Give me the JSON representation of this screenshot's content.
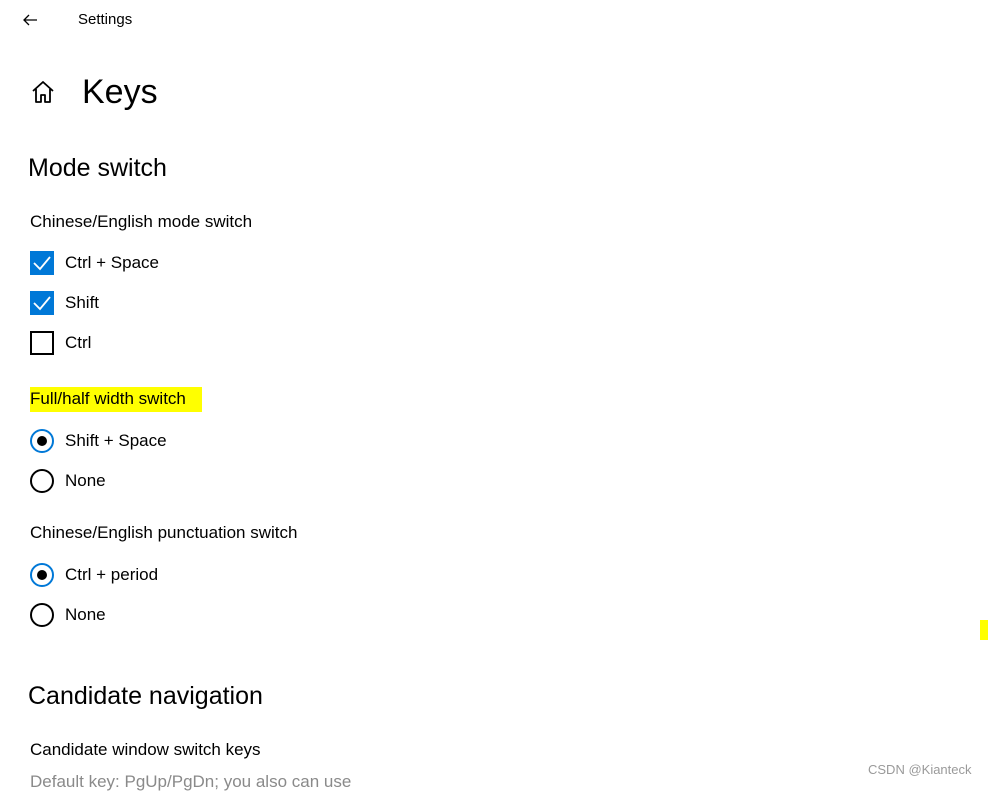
{
  "titlebar": {
    "title": "Settings",
    "back_icon": "back-arrow-icon"
  },
  "header": {
    "home_icon": "home-icon",
    "title": "Keys"
  },
  "sections": {
    "mode_switch": {
      "title": "Mode switch",
      "chinese_english": {
        "label": "Chinese/English mode switch",
        "options": [
          {
            "label": "Ctrl + Space",
            "checked": true
          },
          {
            "label": "Shift",
            "checked": true
          },
          {
            "label": "Ctrl",
            "checked": false
          }
        ]
      },
      "full_half": {
        "label": "Full/half width switch",
        "options": [
          {
            "label": "Shift + Space",
            "selected": true
          },
          {
            "label": "None",
            "selected": false
          }
        ]
      },
      "punctuation": {
        "label": "Chinese/English punctuation switch",
        "options": [
          {
            "label": "Ctrl + period",
            "selected": true
          },
          {
            "label": "None",
            "selected": false
          }
        ]
      }
    },
    "candidate_navigation": {
      "title": "Candidate navigation",
      "window_switch": {
        "label": "Candidate window switch keys",
        "helper": "Default key: PgUp/PgDn; you also can use"
      }
    }
  },
  "watermark": "CSDN @Kianteck",
  "colors": {
    "accent": "#0078d7",
    "highlight": "#ffff00",
    "text": "#000000",
    "muted": "#8a8a8a"
  }
}
